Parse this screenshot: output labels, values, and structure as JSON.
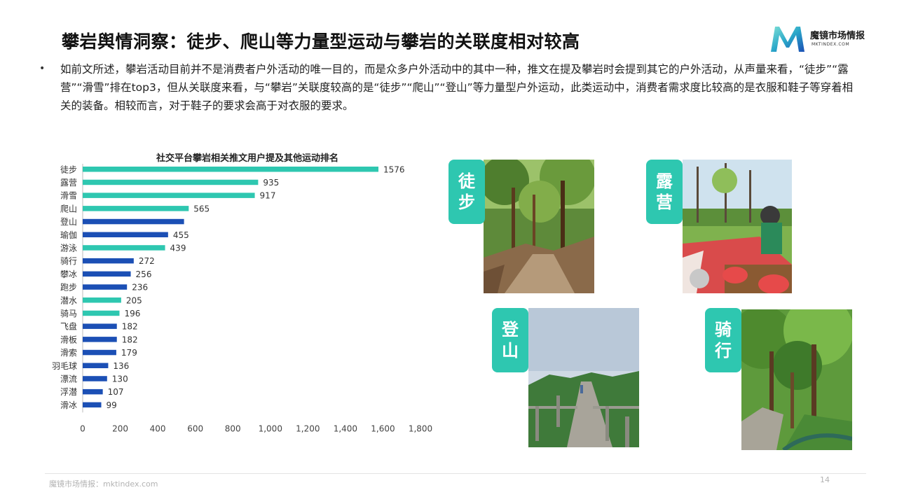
{
  "header": {
    "title": "攀岩舆情洞察：徒步、爬山等力量型运动与攀岩的关联度相对较高",
    "logo_name": "魔镜市场情报",
    "logo_domain": "MKTINDEX.COM"
  },
  "body": {
    "bullet": "•",
    "paragraph": "如前文所述，攀岩活动目前并不是消费者户外活动的唯一目的，而是众多户外活动中的其中一种，推文在提及攀岩时会提到其它的户外活动，从声量来看，“徒步”“露营”“滑雪”排在top3，但从关联度来看，与“攀岩”关联度较高的是“徒步”“爬山”“登山”等力量型户外运动，此类运动中，消费者需求度比较高的是衣服和鞋子等穿着相关的装备。相较而言，对于鞋子的要求会高于对衣服的要求。"
  },
  "chart_data": {
    "type": "bar",
    "orientation": "horizontal",
    "title": "社交平台攀岩相关推文用户提及其他运动排名",
    "categories": [
      "徒步",
      "露营",
      "滑雪",
      "爬山",
      "登山",
      "瑜伽",
      "游泳",
      "骑行",
      "攀冰",
      "跑步",
      "潜水",
      "骑马",
      "飞盘",
      "滑板",
      "滑索",
      "羽毛球",
      "漂流",
      "浮潜",
      "滑冰"
    ],
    "values": [
      1576,
      935,
      917,
      565,
      540,
      455,
      439,
      272,
      256,
      236,
      205,
      196,
      182,
      182,
      179,
      136,
      130,
      107,
      99
    ],
    "labels": [
      "1576",
      "935",
      "917",
      "565",
      "",
      "455",
      "439",
      "272",
      "256",
      "236",
      "205",
      "196",
      "182",
      "182",
      "179",
      "136",
      "130",
      "107",
      "99"
    ],
    "bar_colors": [
      "#2ec7b0",
      "#2ec7b0",
      "#2ec7b0",
      "#2ec7b0",
      "#1b4fb5",
      "#1b4fb5",
      "#2ec7b0",
      "#1b4fb5",
      "#1b4fb5",
      "#1b4fb5",
      "#2ec7b0",
      "#2ec7b0",
      "#1b4fb5",
      "#1b4fb5",
      "#1b4fb5",
      "#1b4fb5",
      "#1b4fb5",
      "#1b4fb5",
      "#1b4fb5"
    ],
    "xlim": [
      0,
      1800
    ],
    "xticks": [
      0,
      200,
      400,
      600,
      800,
      1000,
      1200,
      1400,
      1600,
      1800
    ],
    "xtick_labels": [
      "0",
      "200",
      "400",
      "600",
      "800",
      "1,000",
      "1,200",
      "1,400",
      "1,600",
      "1,800"
    ],
    "xlabel": "",
    "ylabel": "",
    "grid": false,
    "legend": "none"
  },
  "photos": {
    "hiking": {
      "tag": "徒步"
    },
    "camping": {
      "tag": "露营"
    },
    "climbing": {
      "tag": "登山"
    },
    "cycling": {
      "tag": "骑行"
    }
  },
  "footer": {
    "source": "魔镜市场情报：mktindex.com",
    "page_number": "14"
  },
  "colors": {
    "accent_teal": "#2ec7b0",
    "accent_blue": "#1b4fb5"
  }
}
